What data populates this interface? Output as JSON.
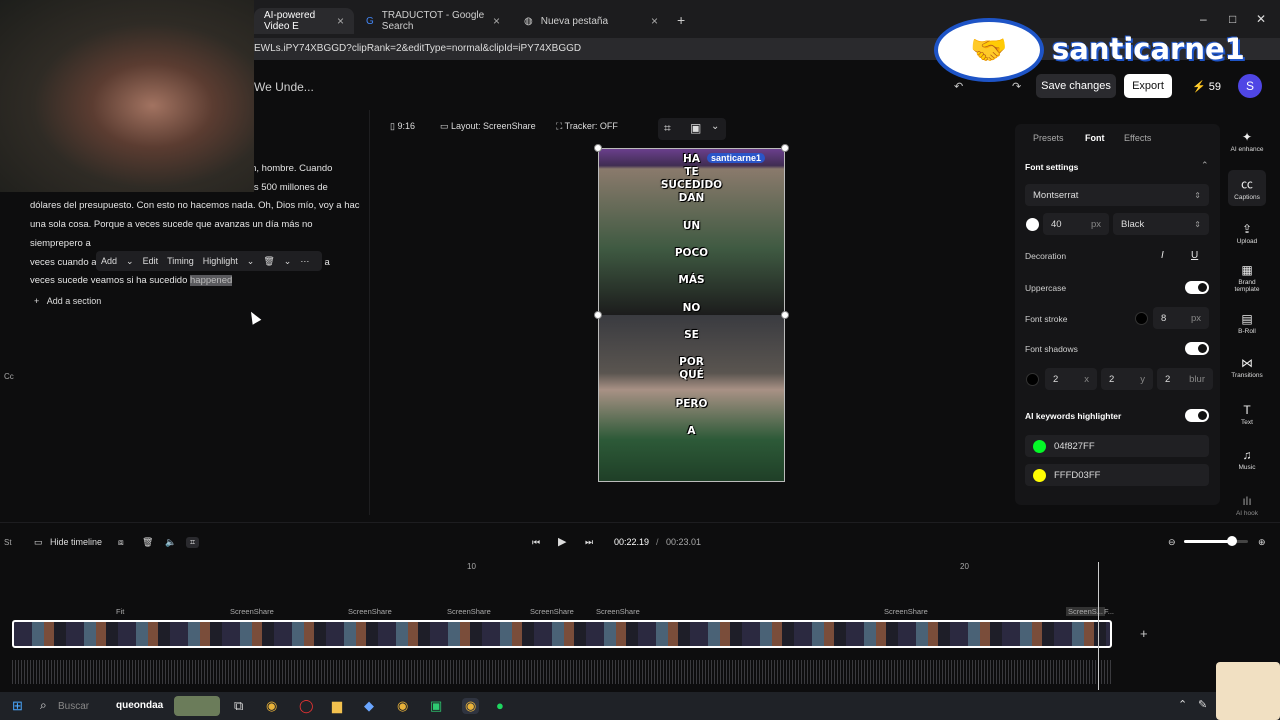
{
  "browser": {
    "tabs": [
      {
        "label": "AI-powered Video E",
        "active": true
      },
      {
        "label": "TRADUCTOT - Google Search",
        "active": false
      },
      {
        "label": "Nueva pestaña",
        "active": false
      }
    ],
    "url": "EWLs.iPY74XBGGD?clipRank=2&editType=normal&clipId=iPY74XBGGD"
  },
  "header": {
    "title": "We Unde...",
    "save_label": "Save changes",
    "export_label": "Export",
    "credits": "⚡ 59",
    "avatar_letter": "S"
  },
  "overlay": {
    "logo_text": "santicarne1",
    "webcam_side_labels": [
      "Cc",
      "St"
    ]
  },
  "transcript": {
    "lines": [
      "ivisión, hombre. Cuando",
      "enos 500 millones de",
      "dólares del presupuesto. Con esto no hacemos nada. Oh, Dios mío, voy a hacer",
      "una sola cosa. Porque a veces sucede que avanzas un día más no",
      "siemprepero a",
      "veces cuando a",
      "veces sucede veamos si ha sucedido"
    ],
    "line6_tail": "a",
    "highlighted_word": "happened",
    "add_section": "Add a section",
    "toolbar": {
      "add": "Add",
      "edit": "Edit",
      "timing": "Timing",
      "highlight": "Highlight"
    }
  },
  "canvas_toolbar": {
    "ratio": "9:16",
    "layout": "Layout: ScreenShare",
    "tracker": "Tracker: OFF"
  },
  "preview": {
    "top_captions": [
      "HA",
      "TE",
      "SUCEDIDO",
      "DAN",
      "UN",
      "POCO",
      "MÁS"
    ],
    "bottom_captions": [
      "NO",
      "SE",
      "POR",
      "QUÉ",
      "PERO",
      "A"
    ],
    "watermark": "santicarne1"
  },
  "font_panel": {
    "tabs": [
      "Presets",
      "Font",
      "Effects"
    ],
    "active_tab": "Font",
    "section_title": "Font settings",
    "font_family": "Montserrat",
    "font_size": "40",
    "size_unit": "px",
    "weight": "Black",
    "decoration_label": "Decoration",
    "decoration_italic": "I",
    "decoration_underline": "U",
    "uppercase_label": "Uppercase",
    "stroke_label": "Font stroke",
    "stroke_value": "8",
    "stroke_unit": "px",
    "shadows_label": "Font shadows",
    "shadow_x": "2",
    "shadow_x_label": "x",
    "shadow_y": "2",
    "shadow_y_label": "y",
    "shadow_blur": "2",
    "shadow_blur_label": "blur",
    "keywords_label": "AI keywords highlighter",
    "color1": "04f827FF",
    "color2": "FFFD03FF",
    "swatch1": "#04f827",
    "swatch2": "#FFFD03"
  },
  "rail": [
    {
      "icon": "ai-enhance",
      "label": "AI enhance"
    },
    {
      "icon": "captions",
      "label": "Captions"
    },
    {
      "icon": "upload",
      "label": "Upload"
    },
    {
      "icon": "brand-template",
      "label": "Brand template"
    },
    {
      "icon": "b-roll",
      "label": "B-Roll"
    },
    {
      "icon": "transitions",
      "label": "Transitions"
    },
    {
      "icon": "text",
      "label": "Text"
    },
    {
      "icon": "music",
      "label": "Music"
    },
    {
      "icon": "ai-hook",
      "label": "AI hook"
    }
  ],
  "timeline": {
    "hide_label": "Hide timeline",
    "current_time": "00:22.19",
    "separator": "/",
    "total_time": "00:23.01",
    "ruler_marks": [
      "10",
      "20"
    ],
    "segments": [
      "Fit",
      "ScreenShare",
      "ScreenShare",
      "ScreenShare",
      "ScreenShare",
      "ScreenShare",
      "ScreenShare",
      "ScreenS...",
      "F..."
    ],
    "zoom_level": 0.75
  },
  "taskbar": {
    "search_text": "Buscar",
    "overlay_text": "queondaa"
  }
}
